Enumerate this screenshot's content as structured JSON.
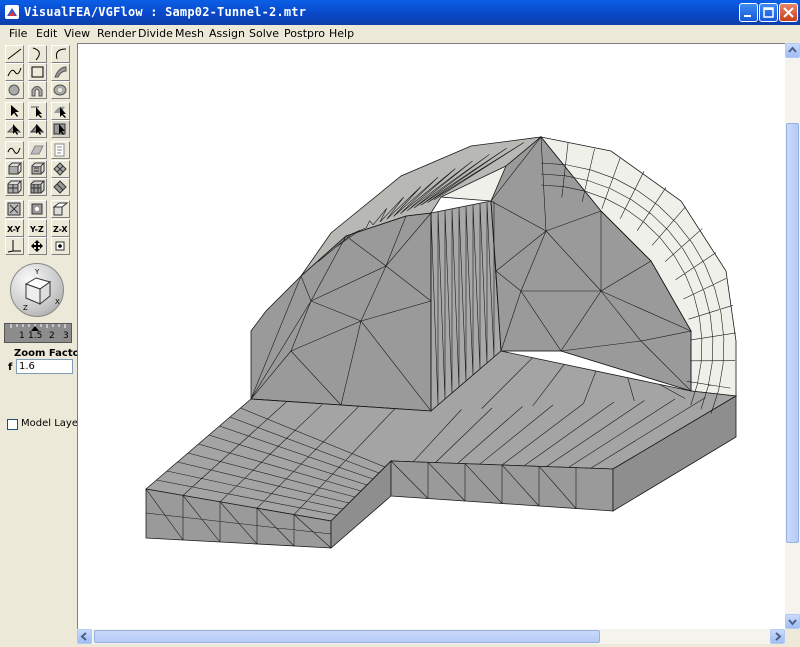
{
  "window": {
    "title": "VisualFEA/VGFlow :  Samp02-Tunnel-2.mtr",
    "app_icon": "visualfea-app-icon",
    "controls": [
      "minimize-icon",
      "maximize-icon",
      "close-icon"
    ]
  },
  "menu": {
    "items": [
      "File",
      "Edit",
      "View",
      "Render",
      "Divide",
      "Mesh",
      "Assign",
      "Solve",
      "Postpro",
      "Help"
    ]
  },
  "toolbar": {
    "groups": [
      [
        "line-tool-icon",
        "arc-tool-icon",
        "curve-tool-icon"
      ],
      [
        "spline-tool-icon",
        "rectangle-tool-icon",
        "surface-tool-icon"
      ],
      [
        "circle-tool-icon",
        "arch-tool-icon",
        "ellipse-tool-icon"
      ],
      [
        "select-pointer-icon",
        "select-edge-icon",
        "select-face-icon"
      ],
      [
        "pick-node-icon",
        "pick-element-icon",
        "pick-region-icon"
      ],
      [
        "curve-sketch-icon",
        "surface-sketch-icon",
        "document-edit-icon"
      ],
      [
        "extrude-icon",
        "revolve-icon",
        "mesh-3d-icon"
      ],
      [
        "block-icon",
        "block-grid-icon",
        "block-merge-icon"
      ],
      [
        "view-fit-icon",
        "view-move-icon",
        "view-iso-icon"
      ],
      [
        "axis-x-y",
        "axis-y-z",
        "axis-z-x"
      ],
      [
        "axis-3d-icon",
        "pan-icon",
        "center-icon"
      ]
    ],
    "axis_labels": [
      "X-Y",
      "Y-Z",
      "Z-X"
    ]
  },
  "navigator": {
    "icon": "orbit-cube-icon",
    "slider_ticks": [
      "1",
      "1.5",
      "2",
      "3"
    ],
    "slider_value": 1.5
  },
  "zoom": {
    "label": "Zoom Factor",
    "prefix": "f",
    "value": "1.6"
  },
  "model_layer": {
    "label": "Model Layer",
    "checked": false
  },
  "viewport": {
    "content": "tunnel-mesh-3d-model",
    "mesh_face_color": "#9a9a9a",
    "mesh_light_color": "#f0f0ea",
    "mesh_edge_color": "#1a1a1a"
  },
  "colors": {
    "title_bar": "#0a5fe6",
    "background": "#ece9d8",
    "viewport_background": "#ffffff"
  }
}
